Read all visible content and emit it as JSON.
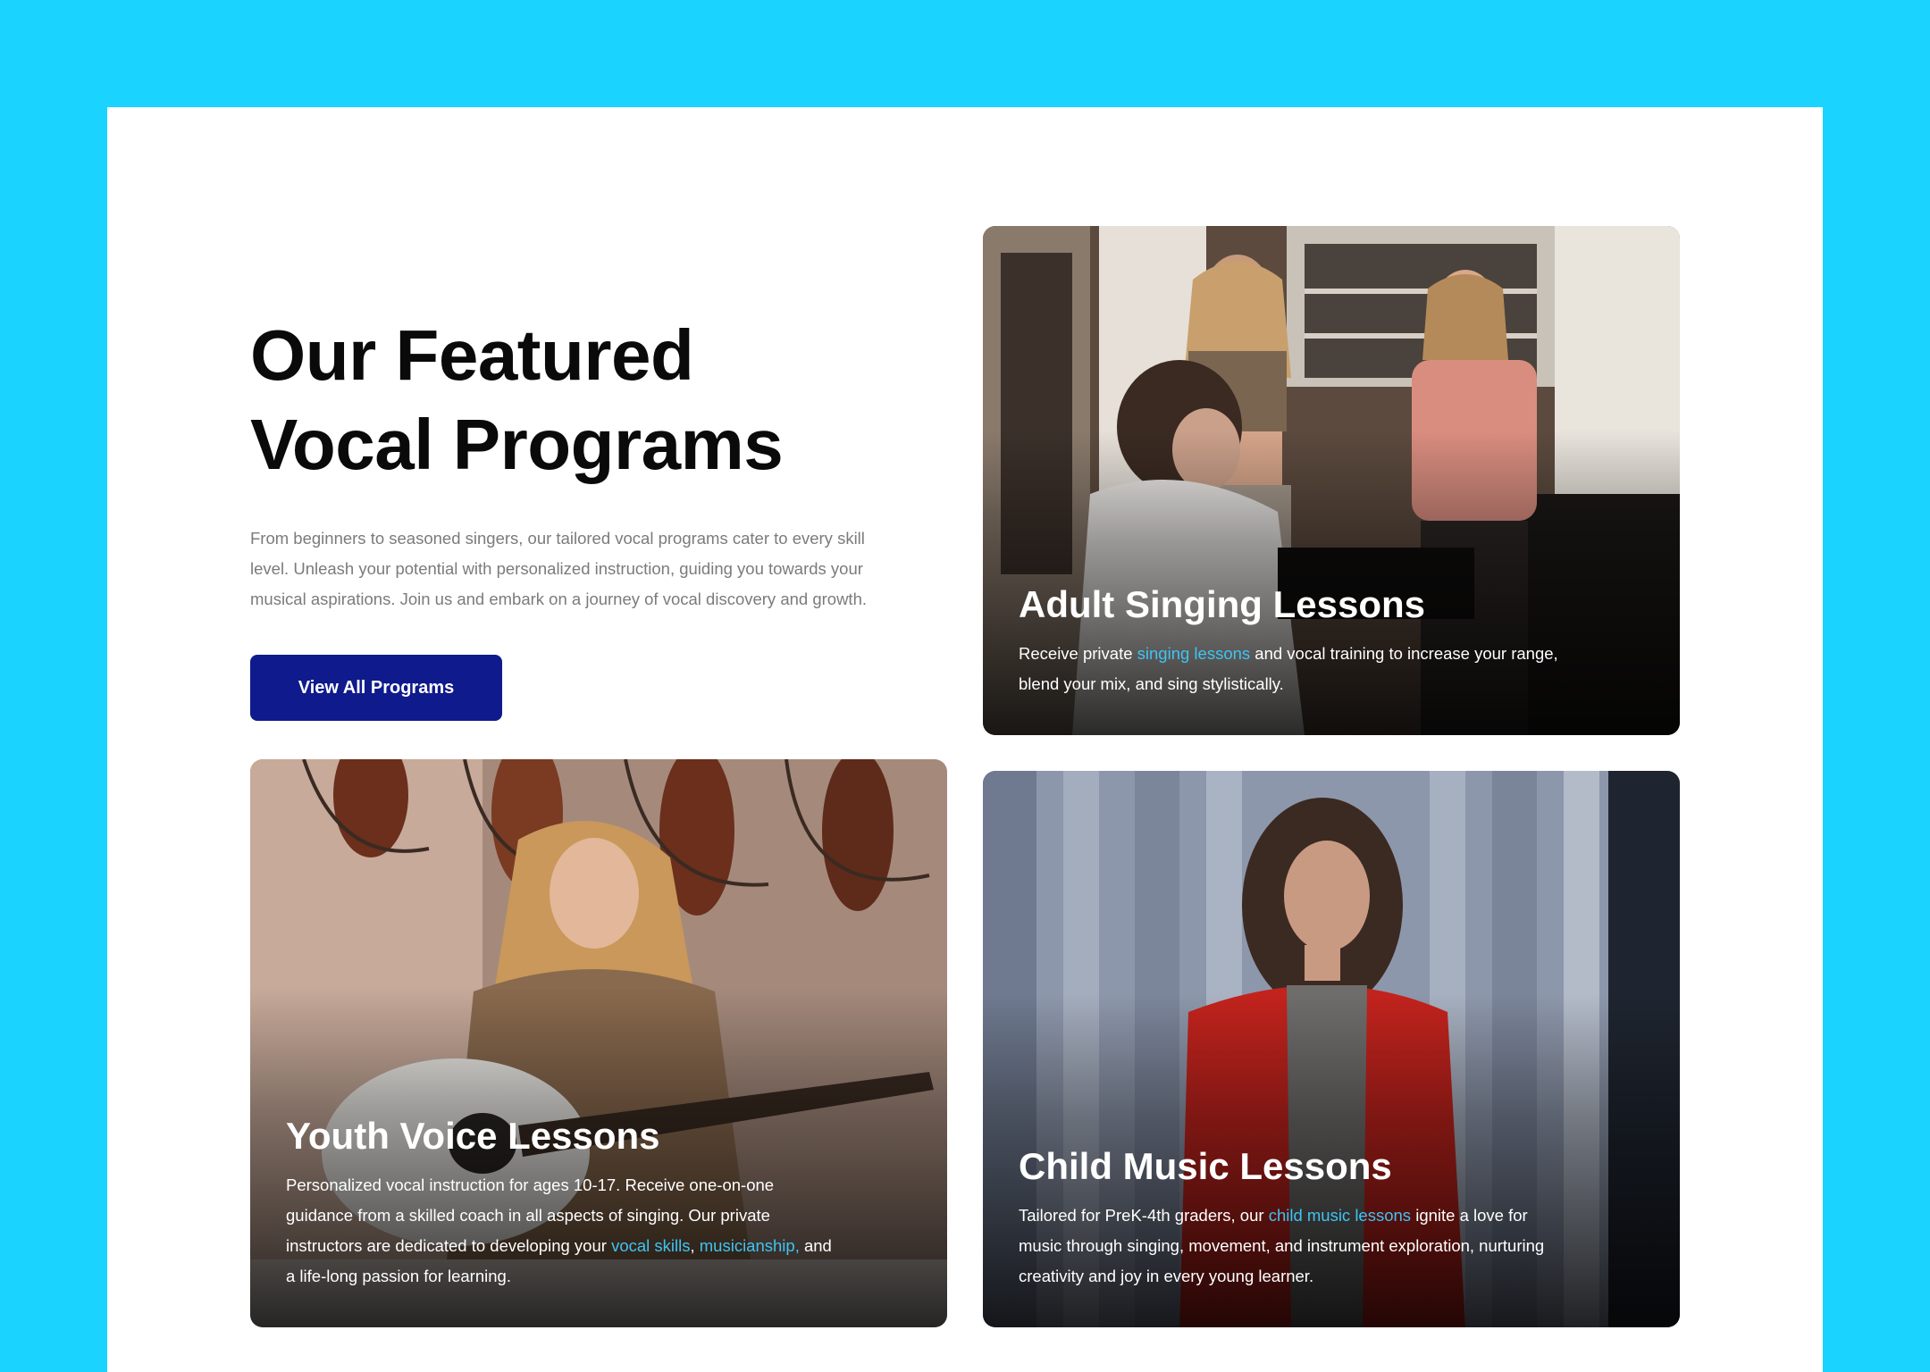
{
  "intro": {
    "title_line1": "Our Featured",
    "title_line2": "Vocal Programs",
    "description": "From beginners to seasoned singers, our tailored vocal programs cater to every skill level. Unleash your potential with personalized instruction, guiding you towards your musical aspirations. Join us and embark on a journey of vocal discovery and growth.",
    "button_label": "View All Programs"
  },
  "cards": {
    "adult": {
      "title": "Adult Singing Lessons",
      "text_before": "Receive private ",
      "link": "singing lessons",
      "text_after": " and vocal training to increase your range, blend your mix, and sing stylistically."
    },
    "youth": {
      "title": "Youth Voice Lessons",
      "text_before": "Personalized vocal instruction for ages 10-17. Receive one-on-one guidance from a skilled coach in all aspects of singing. Our private instructors are dedicated to developing your ",
      "link1": "vocal skills",
      "sep": ", ",
      "link2": "musicianship,",
      "text_after": " and a life-long passion for learning."
    },
    "child": {
      "title": "Child Music Lessons",
      "text_before": "Tailored for PreK-4th graders, our ",
      "link": "child music lessons",
      "text_after": " ignite a love for music through singing, movement, and instrument exploration, nurturing creativity and joy in every young learner."
    }
  },
  "colors": {
    "page_background": "#1ad3ff",
    "panel": "#ffffff",
    "button": "#0f1a8c",
    "link": "#3fc4f2"
  },
  "icons": {
    "adult_photo": "adult-singing-photo",
    "youth_photo": "youth-guitar-photo",
    "child_photo": "child-singing-photo"
  }
}
